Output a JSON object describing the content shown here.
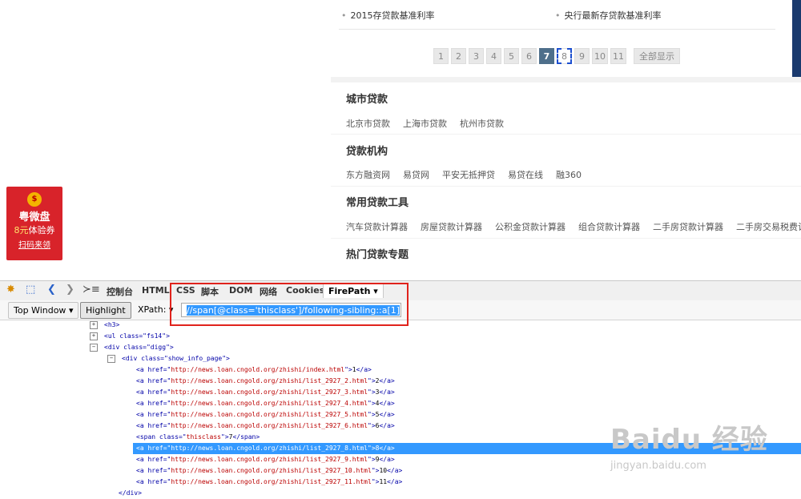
{
  "news": {
    "left": "2015存贷款基准利率",
    "right": "央行最新存贷款基准利率"
  },
  "pager": {
    "pages": [
      "1",
      "2",
      "3",
      "4",
      "5",
      "6",
      "7",
      "8",
      "9",
      "10",
      "11"
    ],
    "current": "7",
    "selected": "8",
    "show_all": "全部显示"
  },
  "sections": [
    {
      "title": "城市贷款",
      "links": [
        "北京市贷款",
        "上海市贷款",
        "杭州市贷款"
      ]
    },
    {
      "title": "贷款机构",
      "links": [
        "东方融资网",
        "易贷网",
        "平安无抵押贷",
        "易贷在线",
        "融360"
      ]
    },
    {
      "title": "常用贷款工具",
      "links": [
        "汽车贷款计算器",
        "房屋贷款计算器",
        "公积金贷款计算器",
        "组合贷款计算器",
        "二手房贷款计算器",
        "二手房交易税费计算"
      ]
    },
    {
      "title": "热门贷款专题"
    }
  ],
  "promo": {
    "title": "粤微盘",
    "amount": "8元",
    "coupon": "体验券",
    "cta": "扫码来领"
  },
  "devtools": {
    "tabs": [
      "控制台",
      "HTML",
      "CSS",
      "脚本",
      "DOM",
      "网络",
      "Cookies",
      "FirePath ▾"
    ],
    "top_window": "Top Window",
    "highlight": "Highlight",
    "xpath_label": "XPath:",
    "xpath_value": "//span[@class='thisclass']/following-sibling::a[1]"
  },
  "tree": {
    "h3": "<h3>",
    "ul": "<ul class=\"fs14\">",
    "div_digg": "<div class=\"digg\">",
    "div_page": "<div class=\"show_info_page\">",
    "links": [
      {
        "href": "http://news.loan.cngold.org/zhishi/index.html",
        "text": "1"
      },
      {
        "href": "http://news.loan.cngold.org/zhishi/list_2927_2.html",
        "text": "2"
      },
      {
        "href": "http://news.loan.cngold.org/zhishi/list_2927_3.html",
        "text": "3"
      },
      {
        "href": "http://news.loan.cngold.org/zhishi/list_2927_4.html",
        "text": "4"
      },
      {
        "href": "http://news.loan.cngold.org/zhishi/list_2927_5.html",
        "text": "5"
      },
      {
        "href": "http://news.loan.cngold.org/zhishi/list_2927_6.html",
        "text": "6"
      }
    ],
    "span": {
      "class": "thisclass",
      "text": "7"
    },
    "selected_link": {
      "href": "http://news.loan.cngold.org/zhishi/list_2927_8.html",
      "text": "8"
    },
    "links_after": [
      {
        "href": "http://news.loan.cngold.org/zhishi/list_2927_9.html",
        "text": "9"
      },
      {
        "href": "http://news.loan.cngold.org/zhishi/list_2927_10.html",
        "text": "10"
      },
      {
        "href": "http://news.loan.cngold.org/zhishi/list_2927_11.html",
        "text": "11"
      }
    ],
    "close_div": "</div>"
  },
  "watermark": {
    "brand": "Baidu 经验",
    "url": "jingyan.baidu.com"
  },
  "colors": {
    "highlight": "#3399ff",
    "pager_current": "#4e6f8b",
    "annotation": "#e0231c",
    "promo": "#d8232a"
  }
}
